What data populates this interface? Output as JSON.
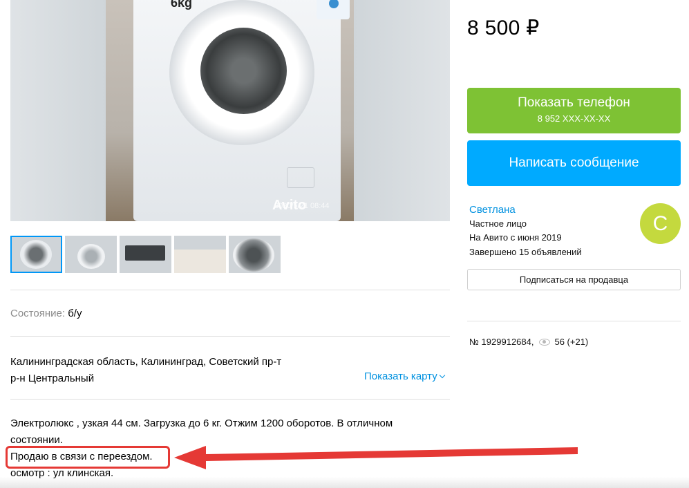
{
  "photo": {
    "badge": "6kg",
    "watermark": "Avito",
    "date": "2020/5/21 08:44"
  },
  "thumbnails": [
    "photo-1",
    "photo-2",
    "photo-3",
    "photo-4",
    "photo-5"
  ],
  "listing": {
    "condition_label": "Состояние:",
    "condition_value": "б/у",
    "address_line1": "Калининградская область, Калининград, Советский пр-т",
    "address_line2": "р-н Центральный",
    "map_link": "Показать карту",
    "description_line1": "Электролюкс , узкая 44 см. Загрузка до 6 кг. Отжим 1200 оборотов. В отличном",
    "description_line2": "состоянии.",
    "description_line3": "Продаю в связи с переездом.",
    "description_line4": "осмотр : ул клинская."
  },
  "sidebar": {
    "price": "8 500 ₽",
    "phone_button_label": "Показать телефон",
    "phone_button_number": "8 952 XXX-XX-XX",
    "message_button_label": "Написать сообщение",
    "seller_name": "Светлана",
    "seller_type": "Частное лицо",
    "seller_since": "На Авито с июня 2019",
    "seller_completed": "Завершено 15 объявлений",
    "avatar_letter": "С",
    "subscribe_label": "Подписаться на продавца",
    "ad_number": "№ 1929912684,",
    "views": "56 (+21)"
  },
  "colors": {
    "phone_button": "#7ec234",
    "message_button": "#00aaff",
    "link": "#0091e0",
    "avatar": "#c4d93e",
    "annotation_red": "#e53935"
  }
}
